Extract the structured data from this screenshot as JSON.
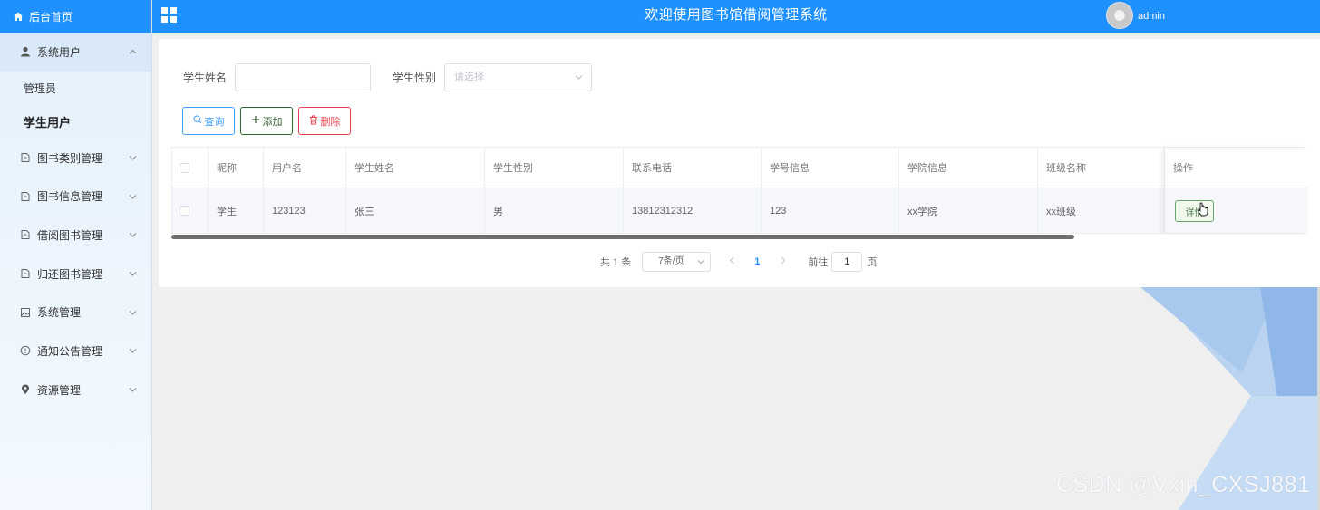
{
  "sidebar": {
    "home_label": "后台首页",
    "menus": [
      {
        "label": "系统用户",
        "icon": "user-icon",
        "open": true,
        "children": [
          {
            "label": "管理员"
          },
          {
            "label": "学生用户",
            "active": true
          }
        ]
      },
      {
        "label": "图书类别管理",
        "icon": "document-icon"
      },
      {
        "label": "图书信息管理",
        "icon": "document-icon"
      },
      {
        "label": "借阅图书管理",
        "icon": "document-icon"
      },
      {
        "label": "归还图书管理",
        "icon": "document-icon"
      },
      {
        "label": "系统管理",
        "icon": "picture-icon"
      },
      {
        "label": "通知公告管理",
        "icon": "info-icon"
      },
      {
        "label": "资源管理",
        "icon": "location-icon"
      }
    ]
  },
  "header": {
    "title": "欢迎使用图书馆借阅管理系统",
    "username": "admin",
    "accent_color": "#1e90ff"
  },
  "search": {
    "name_label": "学生姓名",
    "name_value": "",
    "gender_label": "学生性别",
    "gender_placeholder": "请选择"
  },
  "toolbar": {
    "query_label": "查询",
    "add_label": "添加",
    "delete_label": "删除"
  },
  "table": {
    "columns": [
      "昵称",
      "用户名",
      "学生姓名",
      "学生性别",
      "联系电话",
      "学号信息",
      "学院信息",
      "班级名称",
      "操作"
    ],
    "rows": [
      {
        "nickname": "学生",
        "username": "123123",
        "name": "张三",
        "gender": "男",
        "phone": "13812312312",
        "student_no": "123",
        "college": "xx学院",
        "class_name": "xx班级",
        "action_label": "详情"
      }
    ]
  },
  "pagination": {
    "total_text": "共 1 条",
    "page_size": "7条/页",
    "current_page": "1",
    "goto_label": "前往",
    "goto_value": "1",
    "page_suffix": "页"
  },
  "watermark": "CSDN @Vxin_CXSJ881"
}
